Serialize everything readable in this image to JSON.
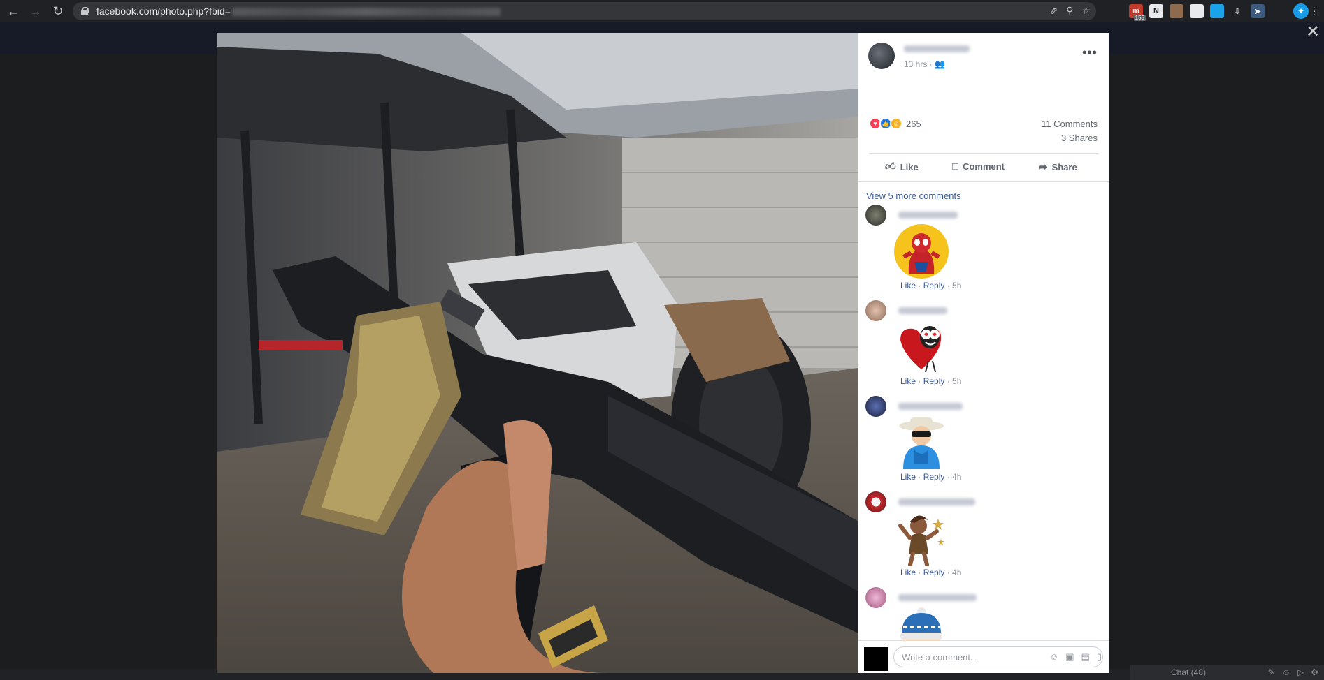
{
  "browser": {
    "url_prefix": "facebook.com/photo.php?fbid=",
    "extension_badge": "155"
  },
  "post": {
    "timestamp": "13 hrs · ",
    "reaction_count": "265",
    "comments_count": "11 Comments",
    "shares_count": "3 Shares",
    "actions": {
      "like": "Like",
      "comment": "Comment",
      "share": "Share"
    },
    "view_more_comments": "View 5 more comments"
  },
  "comments": [
    {
      "like": "Like",
      "reply": "Reply",
      "time": "· 5h"
    },
    {
      "like": "Like",
      "reply": "Reply",
      "time": "· 5h"
    },
    {
      "like": "Like",
      "reply": "Reply",
      "time": "· 4h"
    },
    {
      "like": "Like",
      "reply": "Reply",
      "time": "· 4h"
    }
  ],
  "composer": {
    "placeholder": "Write a comment..."
  },
  "chat": {
    "label": "Chat (48)"
  },
  "colors": {
    "link_blue": "#385898",
    "meta_gray": "#90949c",
    "love_red": "#f33e58",
    "like_blue": "#1877f2"
  }
}
